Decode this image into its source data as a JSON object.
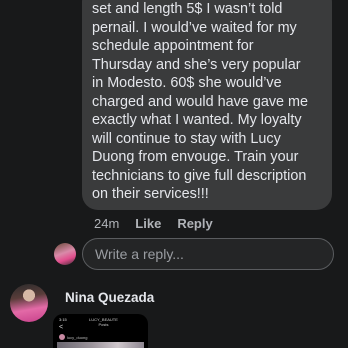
{
  "comment": {
    "lines": [
      "set and length 5$ I wasn’t told",
      "pernail. I would’ve waited for my",
      "schedule appointment for",
      "Thursday and she’s very popular",
      "in Modesto. 60$ she would’ve",
      "charged and would have gave me",
      "exactly what I wanted. My loyalty",
      "will continue to stay with Lucy",
      "Duong from envouge. Train your",
      "technicians to give full description",
      "on their services!!!"
    ],
    "time": "24m",
    "like_label": "Like",
    "reply_label": "Reply"
  },
  "reply_box": {
    "placeholder": "Write a reply..."
  },
  "next_comment": {
    "author": "Nina Quezada",
    "thumbnail": {
      "status_time": "3:15",
      "title_line1": "LUCY_BEAUTE",
      "title_line2": "Posts",
      "back_glyph": "<",
      "username": "lucy_duong"
    }
  },
  "colors": {
    "background": "#18191a",
    "bubble": "#3a3b3c",
    "text_primary": "#e4e6eb",
    "text_secondary": "#b0b3b8"
  },
  "icons": {
    "reply_avatar": "user-avatar",
    "commenter_avatar": "commenter-avatar"
  }
}
